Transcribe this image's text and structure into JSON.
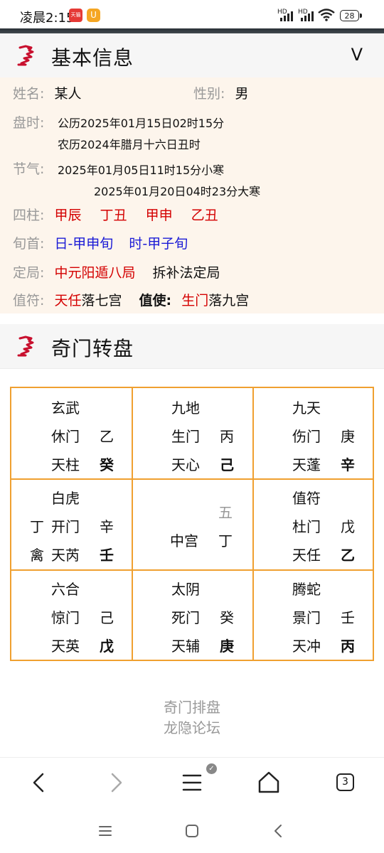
{
  "status_bar": {
    "time": "凌晨2:15",
    "app_badge_1": "天猫",
    "app_badge_2": "U",
    "signal_1": "HD",
    "signal_2": "HD",
    "battery": "28"
  },
  "basic_info": {
    "title": "基本信息",
    "toggle": "V",
    "name_label": "姓名:",
    "name_value": "某人",
    "gender_label": "性别:",
    "gender_value": "男",
    "time_label": "盘时:",
    "solar": "公历2025年01月15日02时15分",
    "lunar": "农历2024年腊月十六日丑时",
    "solar_term_label": "节气:",
    "term_1": "2025年01月05日11时15分小寒",
    "term_2": "2025年01月20日04时23分大寒",
    "pillars_label": "四柱:",
    "pillars": [
      "甲辰",
      "丁丑",
      "甲申",
      "乙丑"
    ],
    "xun_label": "旬首:",
    "xun": [
      "日-甲申旬",
      "时-甲子旬"
    ],
    "ju_label": "定局:",
    "ju_value": "中元阳遁八局",
    "ju_method": "拆补法定局",
    "zhifu_label": "值符:",
    "zhifu_star": "天任",
    "zhifu_palace": "落七宫",
    "zhishi_label": "值使:",
    "zhishi_door": "生门",
    "zhishi_palace": "落九宫"
  },
  "chart_section": {
    "title": "奇门转盘"
  },
  "palaces": [
    {
      "god": "玄武",
      "door": "休门",
      "door_stem": "乙",
      "star": "天柱",
      "star_stem": "癸",
      "left_1": "",
      "left_2": ""
    },
    {
      "god": "九地",
      "door": "生门",
      "door_stem": "丙",
      "star": "天心",
      "star_stem": "己",
      "left_1": "",
      "left_2": ""
    },
    {
      "god": "九天",
      "door": "伤门",
      "door_stem": "庚",
      "star": "天蓬",
      "star_stem": "辛",
      "left_1": "",
      "left_2": ""
    },
    {
      "god": "白虎",
      "door": "开门",
      "door_stem": "辛",
      "star": "天芮",
      "star_stem": "壬",
      "left_1": "丁",
      "left_2": "禽"
    },
    {
      "god": "",
      "door": "中宫",
      "door_stem": "丁",
      "star": "",
      "star_stem": "",
      "left_1": "",
      "left_2": "",
      "top_num": "五"
    },
    {
      "god": "值符",
      "door": "杜门",
      "door_stem": "戊",
      "star": "天任",
      "star_stem": "乙",
      "left_1": "",
      "left_2": ""
    },
    {
      "god": "六合",
      "door": "惊门",
      "door_stem": "己",
      "star": "天英",
      "star_stem": "戊",
      "left_1": "",
      "left_2": ""
    },
    {
      "god": "太阴",
      "door": "死门",
      "door_stem": "癸",
      "star": "天辅",
      "star_stem": "庚",
      "left_1": "",
      "left_2": ""
    },
    {
      "god": "腾蛇",
      "door": "景门",
      "door_stem": "壬",
      "star": "天冲",
      "star_stem": "丙",
      "left_1": "",
      "left_2": ""
    }
  ],
  "footer": {
    "line_1": "奇门排盘",
    "line_2": "龙隐论坛"
  },
  "browser": {
    "tab_count": "3",
    "menu_badge": "✓"
  },
  "colors": {
    "accent_red": "#d40000",
    "accent_blue": "#1a1ad6",
    "grid_border": "#f0a030",
    "panel_bg": "#fdf5ec",
    "logo_red": "#c8102e"
  }
}
